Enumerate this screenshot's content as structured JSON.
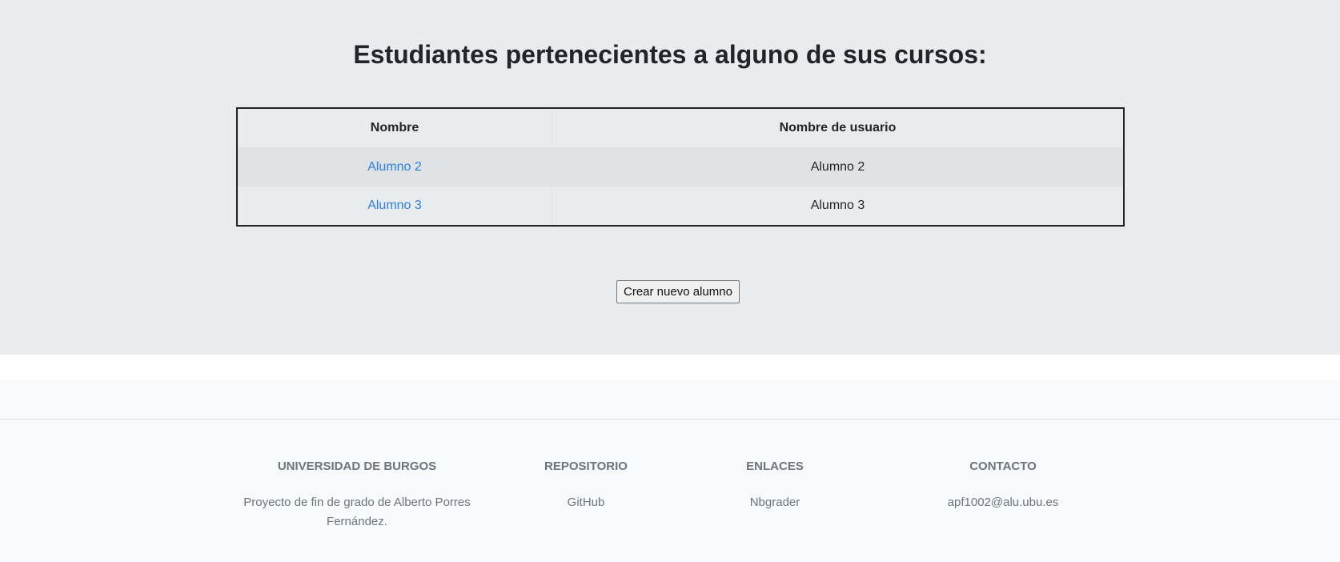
{
  "main": {
    "title": "Estudiantes pertenecientes a alguno de sus cursos:",
    "table": {
      "headers": [
        "Nombre",
        "Nombre de usuario"
      ],
      "rows": [
        {
          "name": "Alumno 2",
          "username": "Alumno 2"
        },
        {
          "name": "Alumno 3",
          "username": "Alumno 3"
        }
      ]
    },
    "create_button_label": "Crear nuevo alumno"
  },
  "footer": {
    "university": {
      "heading": "UNIVERSIDAD DE BURGOS",
      "text": "Proyecto de fin de grado de Alberto Porres Fernández."
    },
    "repository": {
      "heading": "REPOSITORIO",
      "link": "GitHub"
    },
    "links": {
      "heading": "ENLACES",
      "link": "Nbgrader"
    },
    "contact": {
      "heading": "CONTACTO",
      "email": "apf1002@alu.ubu.es"
    }
  },
  "colors": {
    "main_background": "#e9ecef",
    "footer_background": "#f8f9fa",
    "link": "#2d7fe5",
    "muted_text": "#6c757d"
  }
}
